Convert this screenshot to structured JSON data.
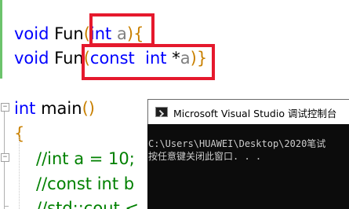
{
  "editor": {
    "code": {
      "line1": {
        "kw_void": "void",
        "fn": "Fun",
        "lp": "(",
        "kw_int": "int",
        "param": "a",
        "rp": ")",
        "brace": "{"
      },
      "line2": {
        "kw_void": "void",
        "fn": "Fun",
        "lp": "(",
        "kw_const": "const",
        "kw_int": "int",
        "star": "*",
        "param": "a",
        "rp": ")",
        "brace": "}"
      },
      "line3": {
        "kw_int": "int",
        "fn": "main",
        "parens": "()"
      },
      "line4": {
        "brace": "{"
      },
      "line5": {
        "comment": "//int a = 10;"
      },
      "line6": {
        "comment": "//const int b"
      },
      "line7": {
        "comment": "//std::cout <"
      }
    },
    "fold_markers": {
      "minus": "−"
    }
  },
  "console": {
    "title": "Microsoft Visual Studio 调试控制台",
    "output_line1": "C:\\Users\\HUAWEI\\Desktop\\2020笔试",
    "output_line2": "按任意键关闭此窗口. . ."
  },
  "colors": {
    "keyword": "#0000ff",
    "parameter": "#808080",
    "brace": "#c98000",
    "comment": "#008000",
    "highlight": "#e5192d",
    "console_bg": "#0c0c0c",
    "console_text": "#cccccc"
  }
}
